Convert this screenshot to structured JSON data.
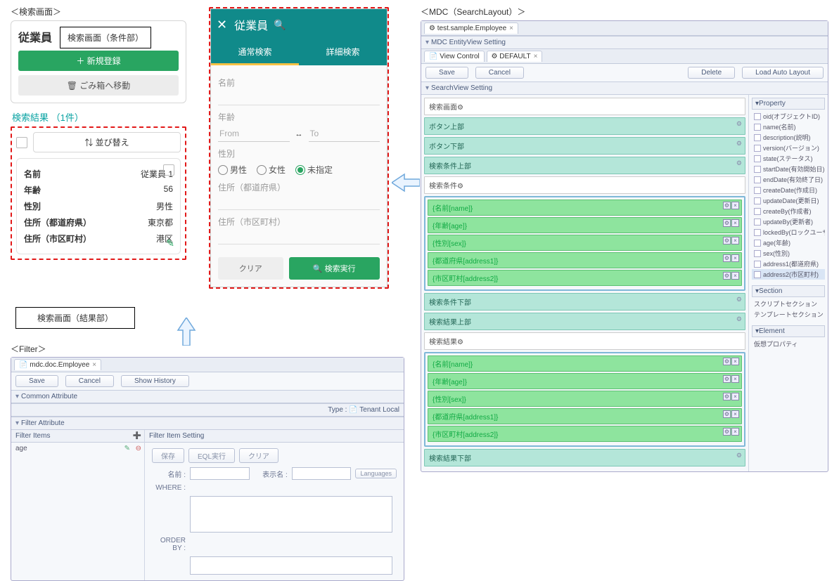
{
  "panelA": {
    "caption": "＜検索画面＞",
    "title": "従業員",
    "callout_cond": "検索画面（条件部）",
    "btn_new": "＋ 新規登録",
    "btn_trash": "🗑 ごみ箱へ移動",
    "result_caption": "検索結果 （1件）",
    "sort_btn": "⇅ 並び替え",
    "item": {
      "k1": "名前",
      "v1": "従業員 1",
      "k2": "年齢",
      "v2": "56",
      "k3": "性別",
      "v3": "男性",
      "k4": "住所（都道府県）",
      "v4": "東京都",
      "k5": "住所（市区町村）",
      "v5": "港区"
    },
    "callout_res": "検索画面（結果部）"
  },
  "panelB": {
    "hdr_title": "従業員",
    "tab1": "通常検索",
    "tab2": "詳細検索",
    "f_name": "名前",
    "f_age": "年齢",
    "age_from": "From",
    "age_to": "To",
    "f_sex": "性別",
    "sex1": "男性",
    "sex2": "女性",
    "sex3": "未指定",
    "f_addr1": "住所（都道府県）",
    "f_addr2": "住所（市区町村）",
    "btn_clear": "クリア",
    "btn_search": "検索実行"
  },
  "panelC": {
    "caption": "＜MDC（SearchLayout）＞",
    "tab": "test.sample.Employee",
    "sec1": "MDC EntityView Setting",
    "tab_vc": "View Control",
    "tab_def": "DEFAULT",
    "btn_save": "Save",
    "btn_cancel": "Cancel",
    "btn_del": "Delete",
    "btn_load": "Load Auto Layout",
    "sec2": "SearchView Setting",
    "slabs": [
      "検索画面",
      "ボタン上部",
      "ボタン下部",
      "検索条件上部"
    ],
    "wlab_cond": "検索条件",
    "cond": [
      "{名前[name]}",
      "{年齢[age]}",
      "{性別[sex]}",
      "{都道府県[address1]}",
      "{市区町村[address2]}"
    ],
    "slabs2": [
      "検索条件下部",
      "検索結果上部"
    ],
    "wlab_res": "検索結果",
    "res": [
      "{名前[name]}",
      "{年齢[age]}",
      "{性別[sex]}",
      "{都道府県[address1]}",
      "{市区町村[address2]}"
    ],
    "slab_bottom": "検索結果下部",
    "prop_hdr": "Property",
    "props": [
      "oid(オブジェクトID)",
      "name(名前)",
      "description(説明)",
      "version(バージョン)",
      "state(ステータス)",
      "startDate(有効開始日)",
      "endDate(有効終了日)",
      "createDate(作成日)",
      "updateDate(更新日)",
      "createBy(作成者)",
      "updateBy(更新者)",
      "lockedBy(ロックユーザ)",
      "age(年齢)",
      "sex(性別)",
      "address1(都道府県)",
      "address2(市区町村)"
    ],
    "prop_sel": 15,
    "sec_hdr": "Section",
    "sec1i": "スクリプトセクション",
    "sec2i": "テンプレートセクション",
    "elem_hdr": "Element",
    "elem1": "仮想プロパティ"
  },
  "panelD": {
    "caption": "＜Filter＞",
    "tab": "mdc.doc.Employee",
    "btn_save": "Save",
    "btn_cancel": "Cancel",
    "btn_hist": "Show History",
    "sec_common": "Common Attribute",
    "type_lbl": "Type :",
    "type_val": "Tenant Local",
    "sec_filter": "Filter Attribute",
    "fi_hdr": "Filter Items",
    "fi_item": "age",
    "fis_hdr": "Filter Item Setting",
    "b1": "保存",
    "b2": "EQL実行",
    "b3": "クリア",
    "l_name": "名前 :",
    "l_disp": "表示名 :",
    "l_lang": "Languages",
    "l_where": "WHERE :",
    "l_order": "ORDER BY :"
  }
}
